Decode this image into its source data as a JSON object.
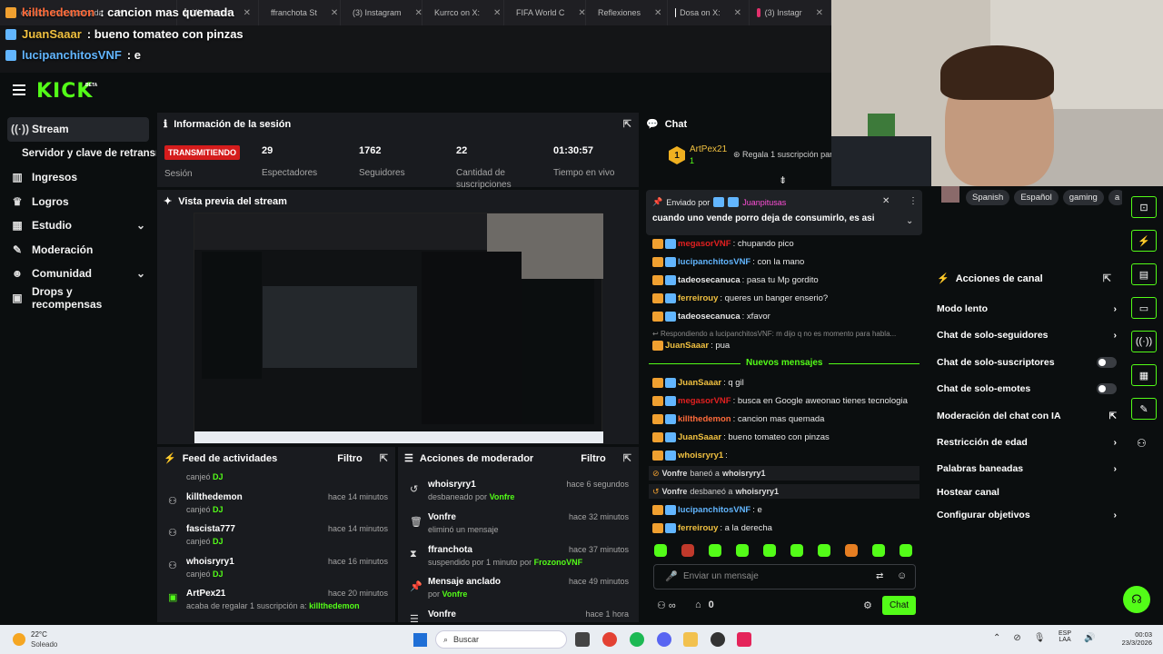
{
  "browser_tabs": [
    {
      "label": "cancion mas quemada",
      "color": "#ff6b6b"
    },
    {
      "label": "(4) Clarent",
      "color": "#8a8a8a"
    },
    {
      "label": "ffranchota St",
      "color": "#53fc18"
    },
    {
      "label": "(3) Instagram",
      "color": "#e1306c"
    },
    {
      "label": "Kurrco on X:",
      "color": "#ffffff"
    },
    {
      "label": "FIFA World C",
      "color": "#ffffff"
    },
    {
      "label": "Reflexiones",
      "color": "#ff0050"
    },
    {
      "label": "Dosa on X:",
      "color": "#ffffff"
    },
    {
      "label": "(3) Instagr",
      "color": "#e1306c"
    }
  ],
  "overlay_chat": [
    {
      "user": "killthedemon",
      "text": ": cancion mas quemada",
      "color": "#ff6b3a"
    },
    {
      "user": "JuanSaaar",
      "text": ": bueno tomateo con pinzas",
      "color": "#f0c040"
    },
    {
      "user": "lucipanchitosVNF",
      "text": ": e",
      "color": "#62b6ff"
    }
  ],
  "header": {
    "logo": "KICK",
    "beta": "BETA"
  },
  "sidebar": {
    "items": [
      {
        "label": "Stream",
        "icon": "broadcast-icon"
      },
      {
        "label": "Servidor y clave de retransm",
        "icon": ""
      },
      {
        "label": "Ingresos",
        "icon": "chart-icon"
      },
      {
        "label": "Logros",
        "icon": "trophy-icon"
      },
      {
        "label": "Estudio",
        "icon": "layout-icon"
      },
      {
        "label": "Moderación",
        "icon": "wrench-icon"
      },
      {
        "label": "Comunidad",
        "icon": "people-icon"
      },
      {
        "label": "Drops y recompensas",
        "icon": "gift-icon"
      }
    ]
  },
  "session": {
    "title": "Información de la sesión",
    "live_badge": "TRANSMITIENDO",
    "live_label": "Sesión",
    "stats": [
      {
        "value": "29",
        "label": "Espectadores"
      },
      {
        "value": "1762",
        "label": "Seguidores"
      },
      {
        "value": "22",
        "label": "Cantidad de suscripciones"
      },
      {
        "value": "01:30:57",
        "label": "Tiempo en vivo"
      }
    ]
  },
  "preview": {
    "title": "Vista previa del stream"
  },
  "activity": {
    "title": "Feed de actividades",
    "filter": "Filtro",
    "items": [
      {
        "user": "",
        "sub_pre": "canjeó ",
        "sub_hl": "DJ",
        "time": ""
      },
      {
        "user": "killthedemon",
        "sub_pre": "canjeó ",
        "sub_hl": "DJ",
        "time": "hace 14 minutos"
      },
      {
        "user": "fascista777",
        "sub_pre": "canjeó ",
        "sub_hl": "DJ",
        "time": "hace 14 minutos"
      },
      {
        "user": "whoisryry1",
        "sub_pre": "canjeó ",
        "sub_hl": "DJ",
        "time": "hace 16 minutos"
      },
      {
        "user": "ArtPex21",
        "sub_pre": "acaba de regalar 1 suscripción a: ",
        "sub_hl": "killthedemon",
        "time": "hace 20 minutos"
      }
    ]
  },
  "modactions": {
    "title": "Acciones de moderador",
    "filter": "Filtro",
    "items": [
      {
        "title": "whoisryry1",
        "sub_pre": "desbaneado por ",
        "sub_hl": "Vonfre",
        "time": "hace 6 segundos"
      },
      {
        "title": "Vonfre",
        "sub_pre": "eliminó un mensaje",
        "sub_hl": "",
        "time": "hace 32 minutos"
      },
      {
        "title": "ffranchota",
        "sub_pre": "suspendido por 1 minuto por ",
        "sub_hl": "FrozonoVNF",
        "time": "hace 37 minutos"
      },
      {
        "title": "Mensaje anclado",
        "sub_pre": "por ",
        "sub_hl": "Vonfre",
        "time": "hace 49 minutos"
      },
      {
        "title": "Vonfre",
        "sub_pre": "",
        "sub_hl": "",
        "time": "hace 1 hora"
      }
    ]
  },
  "chat": {
    "title": "Chat",
    "gift_user": "ArtPex21",
    "gift_count": "1",
    "gift_rank": "1",
    "gift_text": "Regala 1 suscripción para",
    "pinned_by_label": "Enviado por",
    "pinned_user": "Juanpitusas",
    "pinned_text": "cuando uno vende porro deja de consumirlo, es asi",
    "messages": [
      {
        "user": "megasorVNF",
        "text": ": chupando pico",
        "color": "#e02020"
      },
      {
        "user": "lucipanchitosVNF",
        "text": ": con la mano",
        "color": "#62b6ff"
      },
      {
        "user": "tadeosecanuca",
        "text": ": pasa tu Mp gordito",
        "color": "#e8e8e8"
      },
      {
        "user": "ferreirouy",
        "text": ": queres un banger enserio?",
        "color": "#f0c040"
      },
      {
        "user": "tadeosecanuca",
        "text": ": xfavor",
        "color": "#e8e8e8"
      }
    ],
    "reply_label": "Respondiendo a lucipanchitosVNF: m dijo q no es momento para habla...",
    "reply_msg": {
      "user": "JuanSaaar",
      "text": ": pua"
    },
    "new_messages": "Nuevos mensajes",
    "messages2": [
      {
        "user": "JuanSaaar",
        "text": ": q gil",
        "color": "#f0c040"
      },
      {
        "user": "megasorVNF",
        "text": ": busca en Google aweonao tienes tecnologia",
        "color": "#e02020"
      },
      {
        "user": "killthedemon",
        "text": ": cancion mas quemada",
        "color": "#ff6b3a"
      },
      {
        "user": "JuanSaaar",
        "text": ": bueno tomateo con pinzas",
        "color": "#f0c040"
      },
      {
        "user": "whoisryry1",
        "text": ":",
        "color": "#f0c040"
      }
    ],
    "ban_user": "Vonfre",
    "ban_text": "baneó a",
    "ban_target": "whoisryry1",
    "unban_text": "desbaneó a",
    "unban_target": "whoisryry1",
    "messages3": [
      {
        "user": "lucipanchitosVNF",
        "text": ": e",
        "color": "#62b6ff"
      },
      {
        "user": "ferreirouy",
        "text": ": a la derecha",
        "color": "#f0c040"
      }
    ],
    "input_placeholder": "Enviar un mensaje",
    "points": "0",
    "send_label": "Chat"
  },
  "tags": [
    "Spanish",
    "Español",
    "gaming",
    "a"
  ],
  "channel_actions": {
    "title": "Acciones de canal",
    "options": [
      {
        "label": "Modo lento",
        "kind": "chevron"
      },
      {
        "label": "Chat de solo-seguidores",
        "kind": "chevron"
      },
      {
        "label": "Chat de solo-suscriptores",
        "kind": "toggle"
      },
      {
        "label": "Chat de solo-emotes",
        "kind": "toggle"
      },
      {
        "label": "Moderación del chat con IA",
        "kind": "external"
      },
      {
        "label": "Restricción de edad",
        "kind": "chevron"
      },
      {
        "label": "Palabras baneadas",
        "kind": "chevron"
      },
      {
        "label": "Hostear canal",
        "kind": "none"
      },
      {
        "label": "Configurar objetivos",
        "kind": "chevron"
      }
    ]
  },
  "taskbar": {
    "weather_temp": "22°C",
    "weather_desc": "Soleado",
    "search": "Buscar",
    "lang": "ESP",
    "lang2": "LAA",
    "time": "00:03",
    "date": "23/3/2026"
  },
  "colors": {
    "accent": "#53fc18",
    "live": "#d51c1c",
    "panel": "#191b1f"
  }
}
